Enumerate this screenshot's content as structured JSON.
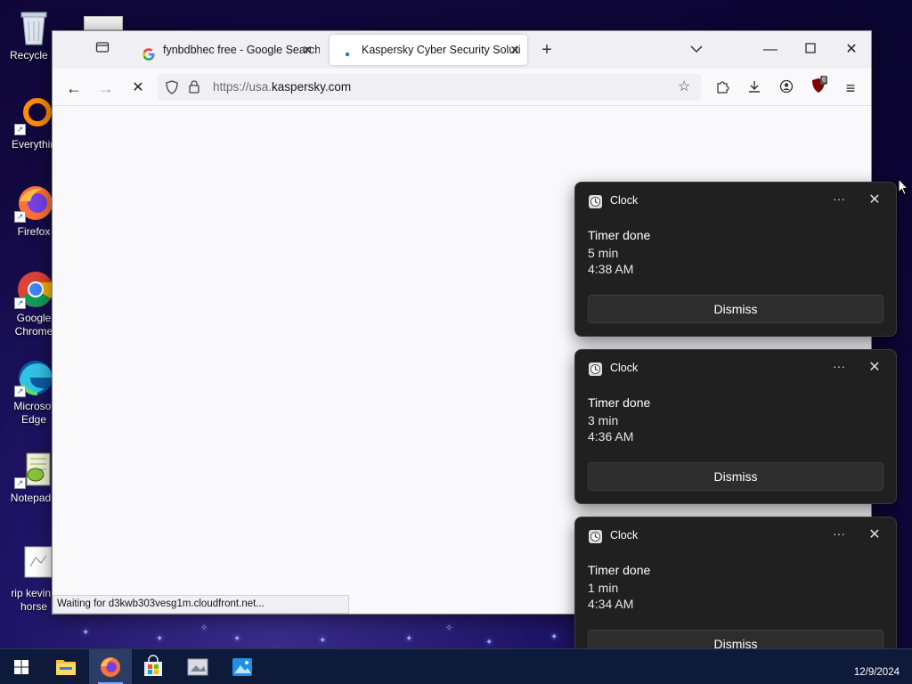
{
  "desktop": {
    "icons": [
      {
        "label": "Recycle Bin",
        "icon": "recycle-bin-icon"
      },
      {
        "label": "Everything",
        "icon": "everything-icon"
      },
      {
        "label": "Firefox",
        "icon": "firefox-icon"
      },
      {
        "label": "Google Chrome",
        "icon": "chrome-icon"
      },
      {
        "label": "Microsoft Edge",
        "icon": "edge-icon"
      },
      {
        "label": "Notepad++",
        "icon": "notepadpp-icon"
      },
      {
        "label": "rip kevin the horse",
        "icon": "image-file-icon"
      }
    ],
    "visible_labels": [
      "Recycle B",
      "Everythin",
      "Firefox",
      "Google\nChrome",
      "Microsof\nEdge",
      "Notepad+",
      "rip kevin t\nhorse"
    ]
  },
  "browser": {
    "tabs": [
      {
        "title": "fynbdbhec free - Google Search",
        "favicon": "google-icon",
        "active": false
      },
      {
        "title": "Kaspersky Cyber Security Soluti",
        "favicon": "loading-dot-icon",
        "active": true
      }
    ],
    "url": {
      "prefix": "https://usa.",
      "domain": "kaspersky.com"
    },
    "status_text": "Waiting for d3kwb303vesg1m.cloudfront.net...",
    "extension_badge": "6"
  },
  "notifications": [
    {
      "app": "Clock",
      "title": "Timer done",
      "duration": "5 min",
      "time": "4:38 AM",
      "button": "Dismiss"
    },
    {
      "app": "Clock",
      "title": "Timer done",
      "duration": "3 min",
      "time": "4:36 AM",
      "button": "Dismiss"
    },
    {
      "app": "Clock",
      "title": "Timer done",
      "duration": "1 min",
      "time": "4:34 AM",
      "button": "Dismiss"
    }
  ],
  "taskbar": {
    "date": "12/9/2024",
    "items": [
      "start-icon",
      "file-explorer-icon",
      "firefox-icon",
      "microsoft-store-icon",
      "image-file-icon",
      "photos-icon"
    ]
  },
  "colors": {
    "accent": "#7aa7ff",
    "toast_bg": "#202020",
    "taskbar_bg": "#0e1a3a"
  }
}
